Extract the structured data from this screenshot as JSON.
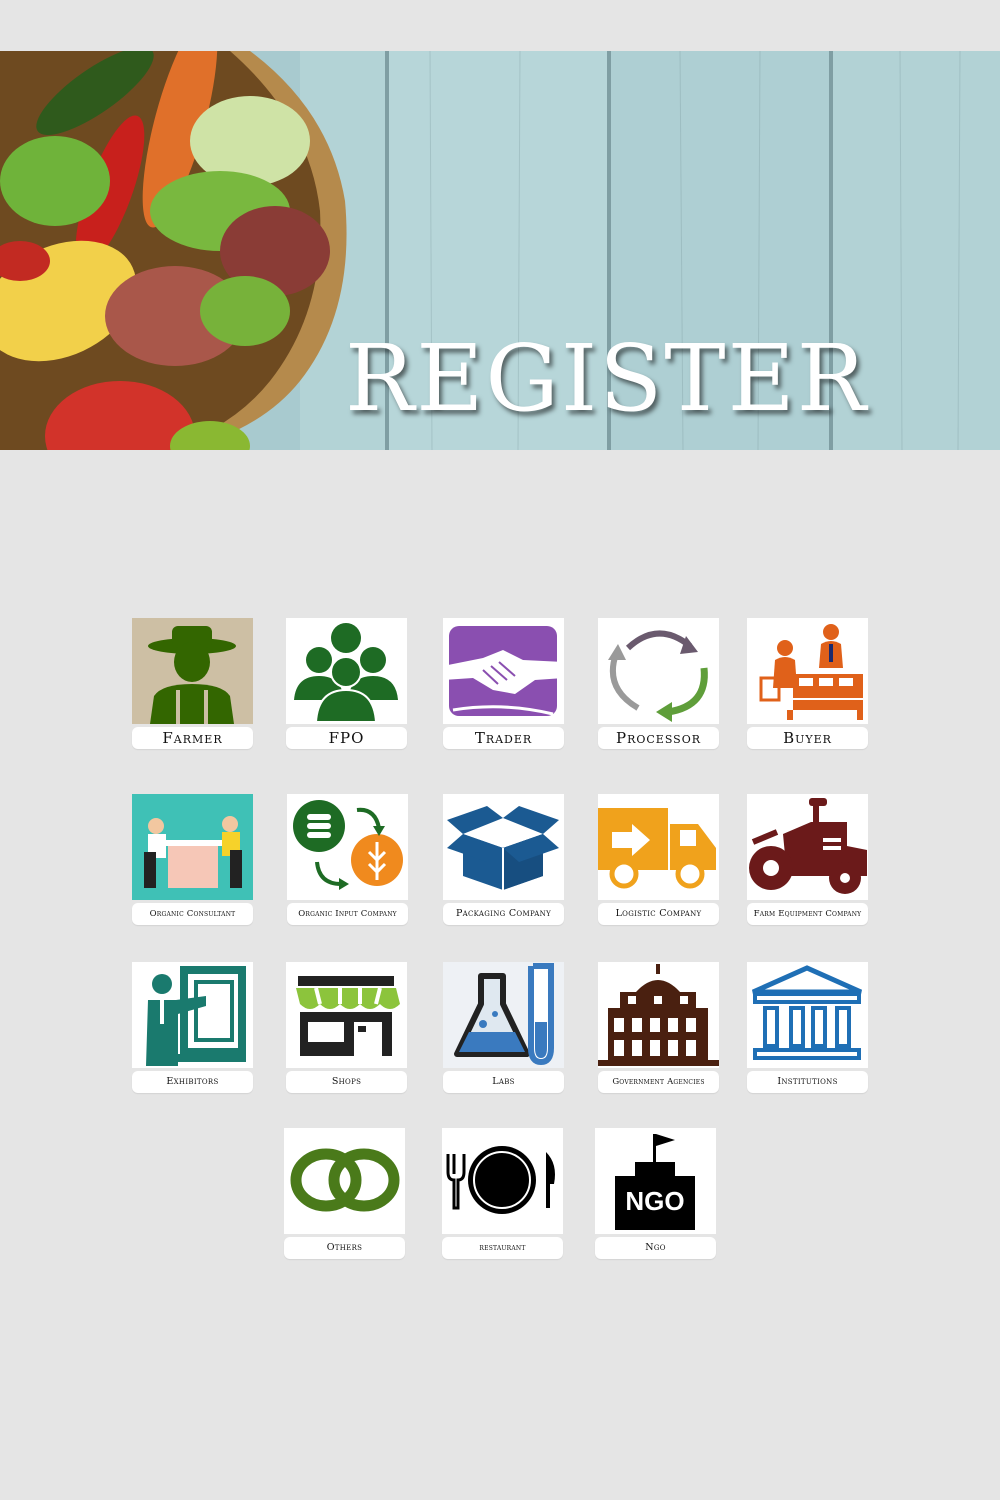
{
  "banner": {
    "title": "REGISTER"
  },
  "tiles": {
    "farmer": {
      "label": "Farmer",
      "icon": "farmer-icon"
    },
    "fpo": {
      "label": "FPO",
      "icon": "group-icon"
    },
    "trader": {
      "label": "Trader",
      "icon": "handshake-icon"
    },
    "processor": {
      "label": "Processor",
      "icon": "cycle-arrows-icon"
    },
    "buyer": {
      "label": "Buyer",
      "icon": "market-stall-icon"
    },
    "organic_consultant": {
      "label": "Organic Consultant",
      "icon": "consultation-icon"
    },
    "organic_input_company": {
      "label": "Organic Input Company",
      "icon": "coins-exchange-icon"
    },
    "packaging_company": {
      "label": "Packaging Company",
      "icon": "open-box-icon"
    },
    "logistic_company": {
      "label": "Logistic Company",
      "icon": "delivery-truck-icon"
    },
    "farm_equipment_company": {
      "label": "Farm Equipment Company",
      "icon": "tractor-icon"
    },
    "exhibitors": {
      "label": "Exhibitors",
      "icon": "presenter-board-icon"
    },
    "shops": {
      "label": "Shops",
      "icon": "storefront-icon"
    },
    "labs": {
      "label": "Labs",
      "icon": "lab-flask-icon"
    },
    "government_agencies": {
      "label": "Government Agencies",
      "icon": "government-building-icon"
    },
    "institutions": {
      "label": "Institutions",
      "icon": "institution-columns-icon"
    },
    "others": {
      "label": "Others",
      "icon": "chain-links-icon"
    },
    "restaurant": {
      "label": "restaurant",
      "icon": "plate-cutlery-icon"
    },
    "ngo": {
      "label": "Ngo",
      "icon": "ngo-building-icon"
    }
  },
  "colors": {
    "page_background": "#e5e5e5",
    "planks": "#a9cbd0",
    "farmer": "#336600",
    "fpo": "#1e6b24",
    "trader": "#8a4fb0",
    "processor": "#5f9e3a",
    "buyer": "#e0611a",
    "packaging": "#1b5a92",
    "logistic": "#f0a21c",
    "tractor": "#6b1a1a",
    "exhibitor": "#1a7a6e",
    "shop": "#8cc43c",
    "lab": "#3a7abf",
    "government": "#4a2010",
    "institution": "#1f6fb5",
    "others": "#4a7a1a"
  }
}
